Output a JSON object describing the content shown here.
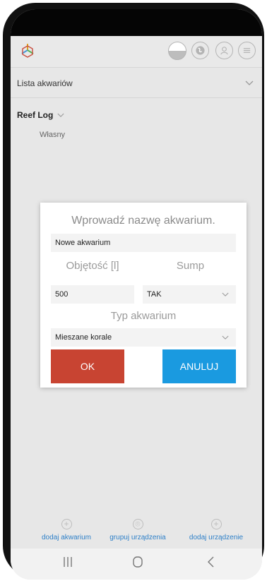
{
  "header": {
    "logo": "aquarium-cube-logo",
    "icons": [
      "half-circle-icon",
      "globe-icon",
      "user-icon",
      "menu-icon"
    ]
  },
  "aquarium_list": {
    "label": "Lista akwariów"
  },
  "group": {
    "name": "Reef Log",
    "items": [
      "Własny"
    ]
  },
  "dialog": {
    "title": "Wprowadź nazwę akwarium.",
    "name_value": "Nowe akwarium",
    "volume_label": "Objętość [l]",
    "volume_value": "500",
    "sump_label": "Sump",
    "sump_value": "TAK",
    "type_label": "Typ akwarium",
    "type_value": "Mieszane korale",
    "ok_label": "OK",
    "cancel_label": "ANULUJ",
    "colors": {
      "ok": "#c84432",
      "cancel": "#1a9ae0"
    }
  },
  "actions": [
    {
      "label": "dodaj akwarium",
      "icon": "plus-circle-icon"
    },
    {
      "label": "grupuj urządzenia",
      "icon": "group-devices-icon"
    },
    {
      "label": "dodaj urządzenie",
      "icon": "plus-circle-icon"
    }
  ],
  "navbar": [
    "recent-apps-icon",
    "home-icon",
    "back-icon"
  ]
}
